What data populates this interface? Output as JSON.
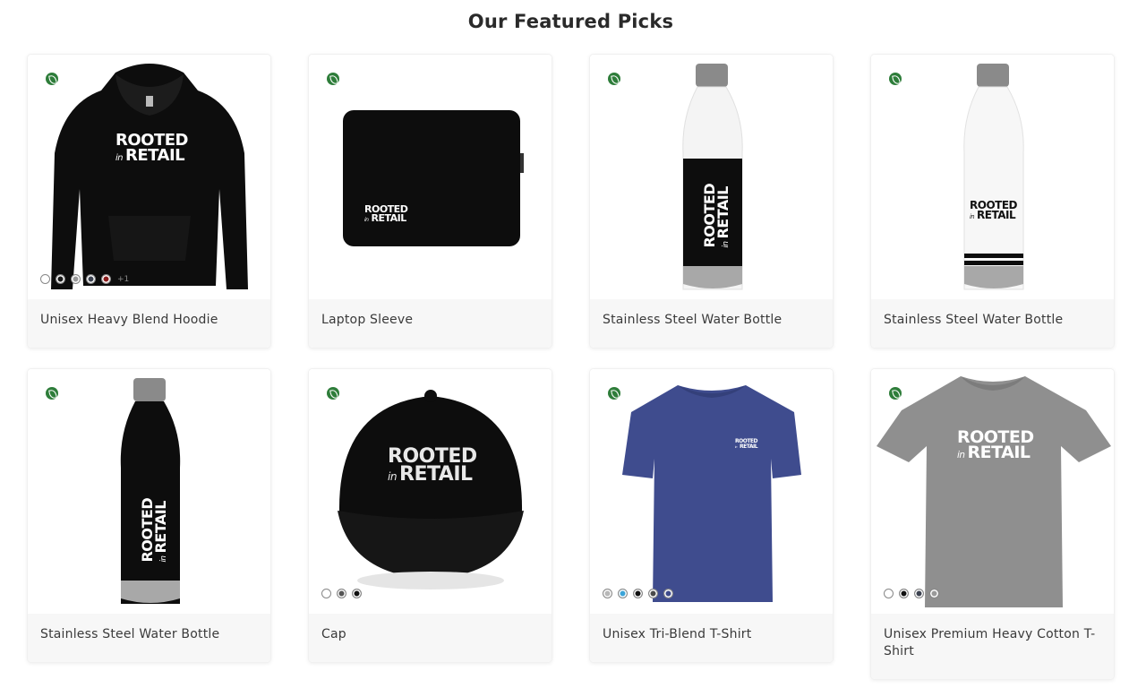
{
  "page": {
    "title": "Our Featured Picks"
  },
  "brand_logo": {
    "line1": "ROOTED",
    "in": "in",
    "line2": "RETAIL"
  },
  "products": [
    {
      "name": "Unisex Heavy Blend Hoodie",
      "swatches": [
        "#ffffff",
        "#1a1a1a",
        "#9a9a9a",
        "#3c4250",
        "#8b1c1c"
      ],
      "more": "+1"
    },
    {
      "name": "Laptop Sleeve",
      "swatches": []
    },
    {
      "name": "Stainless Steel Water Bottle",
      "swatches": []
    },
    {
      "name": "Stainless Steel Water Bottle",
      "swatches": []
    },
    {
      "name": "Stainless Steel Water Bottle",
      "swatches": []
    },
    {
      "name": "Cap",
      "swatches": [
        "#ffffff",
        "#555555",
        "#111111"
      ]
    },
    {
      "name": "Unisex Tri-Blend T-Shirt",
      "swatches": [
        "#b8b8b8",
        "#3ba4d8",
        "#111111",
        "#4a4a4a",
        "#3d4a8a"
      ]
    },
    {
      "name": "Unisex Premium Heavy Cotton T-Shirt",
      "swatches": [
        "#ffffff",
        "#111111",
        "#3c4250",
        "#9a9a9a"
      ]
    }
  ],
  "icons": {
    "eco_badge": "leaf-icon"
  },
  "colors": {
    "eco_badge": "#2e7d3a",
    "caption_bg": "#f7f7f7"
  }
}
